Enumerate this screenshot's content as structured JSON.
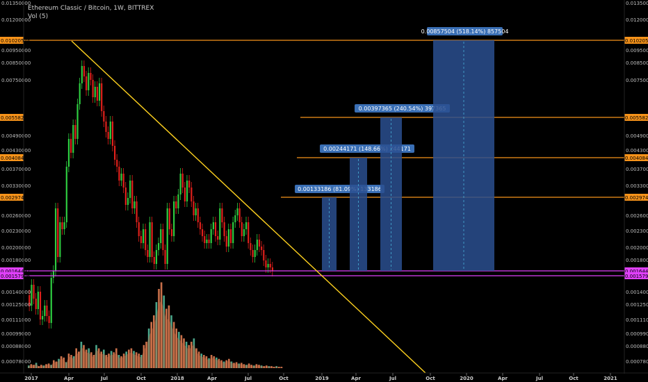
{
  "header": {
    "title": "Ethereum Classic / Bitcoin, 1W, BITTREX",
    "indicator": "Vol (5)"
  },
  "colors": {
    "up": "#2ecc40",
    "down": "#e0201b",
    "orange": "#f7931a",
    "magenta": "#e040fb",
    "trend": "#ffd21f",
    "box": "#2a4f8f",
    "vol_up": "#4aa58a",
    "vol_down": "#c9704a"
  },
  "chart_data": {
    "type": "candlestick",
    "y_scale": "log",
    "ylim": [
      0.0075,
      0.0135
    ],
    "y_ticks": [
      "0.01350000",
      "0.01200000",
      "0.00950000",
      "0.00850000",
      "0.00750000",
      "0.00490000",
      "0.00430000",
      "0.00370000",
      "0.00330000",
      "0.00260000",
      "0.00230000",
      "0.00200000",
      "0.00180000",
      "0.00140000",
      "0.00125000",
      "0.00111000",
      "0.00099000",
      "0.00088000",
      "0.00078000"
    ],
    "x_ticks": [
      "2017",
      "Apr",
      "Jul",
      "Oct",
      "2018",
      "Apr",
      "Jul",
      "Oct",
      "2019",
      "Apr",
      "Jul",
      "Oct",
      "2020",
      "Apr",
      "Jul",
      "Oct",
      "2021"
    ],
    "price_levels": [
      {
        "label": "0.01020574",
        "color": "orange"
      },
      {
        "label": "0.00558214",
        "color": "orange"
      },
      {
        "label": "0.00408423",
        "color": "orange"
      },
      {
        "label": "0.00297438",
        "color": "orange"
      },
      {
        "label": "0.00164497",
        "color": "magenta"
      },
      {
        "label": "0.00157906",
        "color": "magenta"
      }
    ],
    "target_boxes": [
      {
        "label": "0.00133186 (81.09%) 133186"
      },
      {
        "label": "0.00244171 (148.66%) 244171"
      },
      {
        "label": "0.00397365 (240.54%) 397365"
      },
      {
        "label": "0.00857504 (518.14%) 857504"
      }
    ]
  }
}
